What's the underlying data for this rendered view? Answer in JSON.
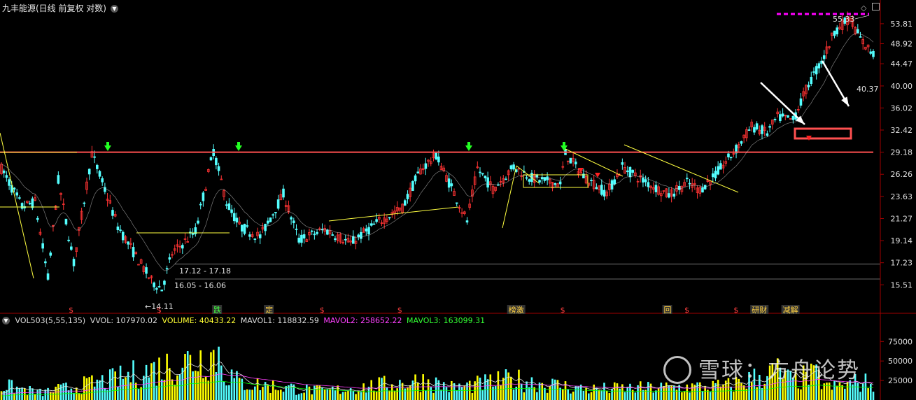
{
  "window": {
    "title": "九丰能源(日线 前复权 对数)",
    "dropdown_icon": "chevron-down-icon",
    "top_icons": [
      "diamond-icon",
      "panel-toggle-icon"
    ]
  },
  "chart_data": {
    "type": "candlestick",
    "scale": "log",
    "ylim": [
      14.0,
      57.5
    ],
    "price_ticks": [
      "53.81",
      "48.92",
      "44.47",
      "40.00",
      "36.02",
      "32.42",
      "29.18",
      "26.26",
      "23.63",
      "21.27",
      "19.14",
      "17.23",
      "15.51"
    ],
    "price_tick_values": [
      53.81,
      48.92,
      44.47,
      40.0,
      36.02,
      32.42,
      29.18,
      26.26,
      23.63,
      21.27,
      19.14,
      17.23,
      15.51
    ],
    "bar_count": 305,
    "key_points": [
      [
        0,
        27.0
      ],
      [
        8,
        22.5
      ],
      [
        13,
        23.0
      ],
      [
        18,
        16.0
      ],
      [
        22,
        25.5
      ],
      [
        28,
        17.2
      ],
      [
        35,
        29.0
      ],
      [
        45,
        20.5
      ],
      [
        50,
        18.5
      ],
      [
        58,
        15.8
      ],
      [
        62,
        15.2
      ],
      [
        66,
        18.0
      ],
      [
        75,
        20.0
      ],
      [
        82,
        29.4
      ],
      [
        87,
        23.0
      ],
      [
        92,
        20.5
      ],
      [
        100,
        19.5
      ],
      [
        109,
        23.9
      ],
      [
        115,
        19.2
      ],
      [
        125,
        20.2
      ],
      [
        135,
        18.9
      ],
      [
        145,
        20.8
      ],
      [
        155,
        22.4
      ],
      [
        162,
        26.8
      ],
      [
        168,
        28.8
      ],
      [
        175,
        24.0
      ],
      [
        180,
        21.0
      ],
      [
        184,
        27.0
      ],
      [
        190,
        24.5
      ],
      [
        198,
        27.2
      ],
      [
        205,
        25.8
      ],
      [
        216,
        25.0
      ],
      [
        218,
        29.0
      ],
      [
        225,
        26.0
      ],
      [
        234,
        24.0
      ],
      [
        240,
        27.2
      ],
      [
        248,
        25.5
      ],
      [
        258,
        23.8
      ],
      [
        265,
        25.2
      ],
      [
        270,
        24.4
      ],
      [
        276,
        26.2
      ],
      [
        284,
        29.6
      ],
      [
        290,
        33.0
      ],
      [
        296,
        32.0
      ],
      [
        300,
        34.5
      ],
      [
        306,
        34.0
      ],
      [
        312,
        40.4
      ],
      [
        318,
        46.0
      ],
      [
        322,
        52.0
      ],
      [
        328,
        55.3
      ],
      [
        332,
        50.0
      ],
      [
        337,
        46.5
      ]
    ],
    "resistance_line": 29.18,
    "lower_lines": [
      17.23,
      16.05
    ],
    "annotations": {
      "high_label": "55.33",
      "level_label": "40.37",
      "low_label": "14.11",
      "range_labels": [
        "17.12 - 17.18",
        "16.05 - 16.06"
      ]
    },
    "event_markers": [
      {
        "label": "$",
        "bar": 26
      },
      {
        "label": "$",
        "bar": 60
      },
      {
        "label": "跌",
        "bar": 82
      },
      {
        "label": "定",
        "bar": 102
      },
      {
        "label": "$",
        "bar": 123
      },
      {
        "label": "$",
        "bar": 153
      },
      {
        "label": "榜激",
        "bar": 196
      },
      {
        "label": "$",
        "bar": 216
      },
      {
        "label": "回",
        "bar": 256
      },
      {
        "label": "$",
        "bar": 264
      },
      {
        "label": "$",
        "bar": 283
      },
      {
        "label": "研财",
        "bar": 290
      },
      {
        "label": "减解",
        "bar": 302
      }
    ],
    "volume": {
      "label_prefix": "VOL503(5,55,135)",
      "vvol": "VVOL: 107970.02",
      "volume": "VOLUME: 40433.22",
      "mavol1": "MAVOL1: 118832.59",
      "mavol2": "MAVOL2: 258652.22",
      "mavol3": "MAVOL3: 163099.31",
      "ticks": [
        "75000",
        "50000",
        "25000"
      ],
      "tick_values": [
        75000,
        50000,
        25000
      ],
      "ylim": [
        0,
        95000
      ],
      "peaks": [
        [
          0,
          30000
        ],
        [
          15,
          15000
        ],
        [
          42,
          40000
        ],
        [
          84,
          95000
        ],
        [
          86,
          60000
        ],
        [
          92,
          35000
        ],
        [
          125,
          18000
        ],
        [
          163,
          40000
        ],
        [
          175,
          25000
        ],
        [
          198,
          42000
        ],
        [
          226,
          22000
        ],
        [
          280,
          28000
        ],
        [
          300,
          58000
        ],
        [
          305,
          40000
        ],
        [
          315,
          50000
        ],
        [
          320,
          25000
        ],
        [
          330,
          35000
        ]
      ]
    },
    "colors": {
      "up": "#ff3333",
      "down": "#54ffff",
      "resistance": "#ff5050",
      "trendline": "#ffff40",
      "ma_white": "#e0e0e0",
      "magenta": "#ff00ff",
      "green_marker": "#22ff22",
      "vol_yellow": "#ffff00",
      "vol_magenta": "#ff40ff",
      "vol_green": "#00ff00",
      "axis": "#a00000"
    }
  },
  "watermark": {
    "text": "雪球：方舟论势",
    "icon": "xueqiu-logo-icon"
  }
}
